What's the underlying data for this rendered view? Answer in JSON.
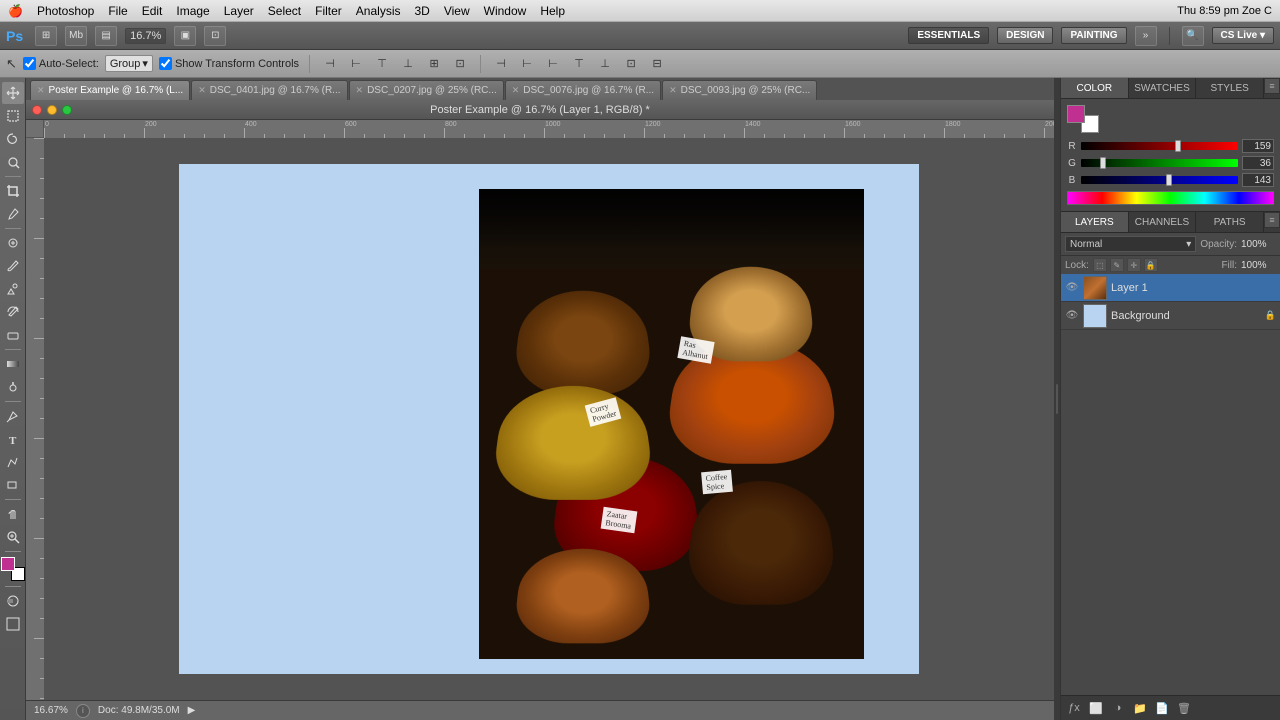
{
  "os": {
    "titlebar": {
      "apple": "🍎",
      "menus": [
        "Photoshop",
        "File",
        "Edit",
        "Image",
        "Layer",
        "Select",
        "Filter",
        "Analysis",
        "3D",
        "View",
        "Window",
        "Help"
      ],
      "right_status": "Thu 8:59 pm   Zoe C"
    }
  },
  "topbar": {
    "logo": "Ps",
    "zoom": "16.7%",
    "workspace_buttons": [
      "ESSENTIALS",
      "DESIGN",
      "PAINTING"
    ],
    "active_workspace": "ESSENTIALS",
    "cs_live": "CS Live ▾"
  },
  "optionsbar": {
    "auto_select_label": "Auto-Select:",
    "auto_select_value": "Group",
    "show_transform_label": "Show Transform Controls",
    "show_transform_checked": true
  },
  "window_title": "Poster Example @ 16.7% (Layer 1, RGB/8) *",
  "tabs": [
    {
      "label": "Poster Example @ 16.7% (L...",
      "active": true
    },
    {
      "label": "DSC_0401.jpg @ 16.7% (R...",
      "active": false
    },
    {
      "label": "DSC_0207.jpg @ 25% (RC...",
      "active": false
    },
    {
      "label": "DSC_0076.jpg @ 16.7% (R...",
      "active": false
    },
    {
      "label": "DSC_0093.jpg @ 25% (RC...",
      "active": false
    }
  ],
  "canvas": {
    "background_color": "#b8d4f0"
  },
  "statusbar": {
    "zoom": "16.67%",
    "doc_size": "Doc: 49.8M/35.0M"
  },
  "color_panel": {
    "tabs": [
      "COLOR",
      "SWATCHES",
      "STYLES"
    ],
    "active_tab": "COLOR",
    "fg_color": "#c03090",
    "bg_color": "#ffffff",
    "r_label": "R",
    "r_value": "159",
    "g_label": "G",
    "g_value": "36",
    "b_label": "B",
    "b_value": "143"
  },
  "layers_panel": {
    "tabs": [
      "LAYERS",
      "CHANNELS",
      "PATHS"
    ],
    "active_tab": "LAYERS",
    "blend_mode": "Normal",
    "opacity_label": "Opacity:",
    "opacity_value": "100%",
    "fill_label": "Fill:",
    "fill_value": "100%",
    "lock_label": "Lock:",
    "layers": [
      {
        "name": "Layer 1",
        "visible": true,
        "active": true,
        "thumb_color": "#a06030"
      },
      {
        "name": "Background",
        "visible": true,
        "active": false,
        "thumb_color": "#b8d4f0",
        "locked": true
      }
    ]
  },
  "tools": [
    "move",
    "selection-marquee",
    "lasso",
    "quick-select",
    "crop",
    "eyedropper",
    "spot-heal",
    "brush",
    "clone-stamp",
    "history-brush",
    "eraser",
    "gradient",
    "dodge",
    "pen",
    "text",
    "path-select",
    "shape",
    "zoom-out",
    "zoom-in",
    "hand",
    "zoom"
  ]
}
